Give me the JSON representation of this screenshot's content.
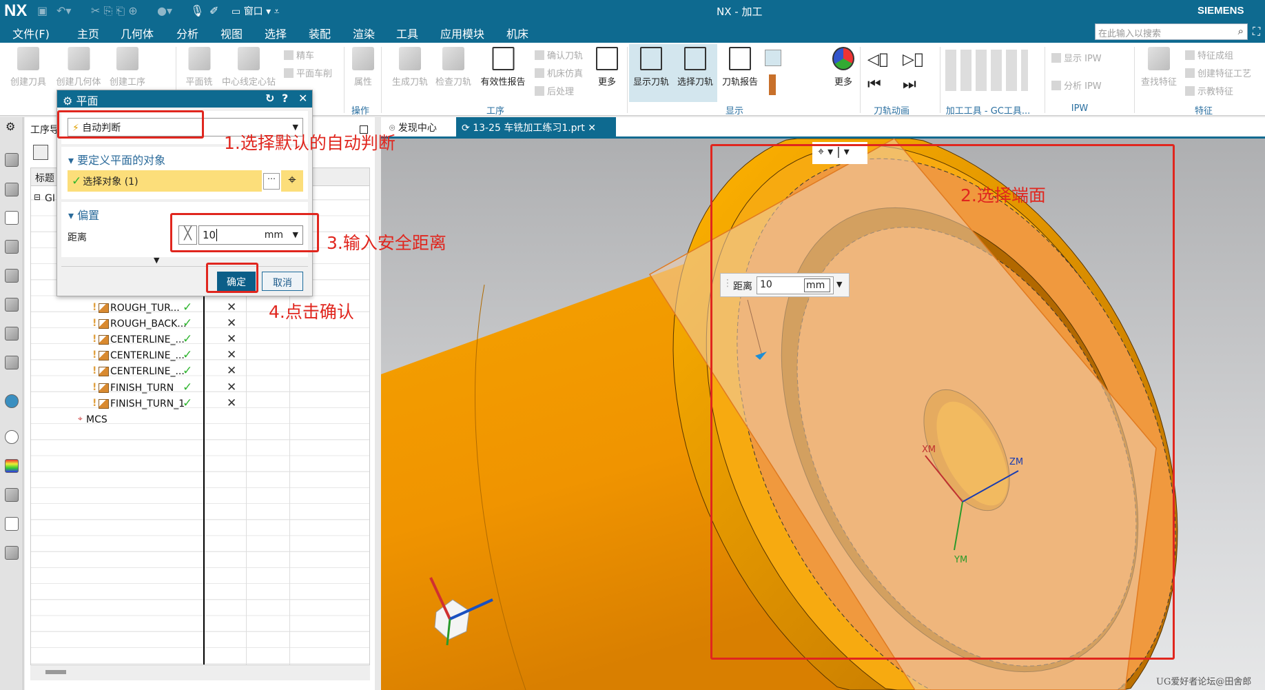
{
  "app": {
    "logo": "NX",
    "title": "NX - 加工",
    "brand": "SIEMENS",
    "window_menu": "窗口"
  },
  "menu": [
    "文件(F)",
    "主页",
    "几何体",
    "分析",
    "视图",
    "选择",
    "装配",
    "渲染",
    "工具",
    "应用模块",
    "机床"
  ],
  "search": {
    "placeholder": "在此输入以搜索"
  },
  "ribbon": {
    "buttons": [
      "创建刀具",
      "创建几何体",
      "创建工序",
      "平面铣",
      "中心线定心钻",
      "属性",
      "生成刀轨",
      "检查刀轨",
      "有效性报告",
      "更多",
      "显示刀轨",
      "选择刀轨",
      "刀轨报告",
      "更多",
      "查找特征"
    ],
    "small": [
      "精车",
      "平面车削",
      "确认刀轨",
      "机床仿真",
      "后处理",
      "显示 IPW",
      "分析 IPW",
      "特征成组",
      "创建特征工艺",
      "示教特征"
    ],
    "groups": [
      "操作",
      "工序",
      "显示",
      "刀轨动画",
      "加工工具 - GC工具...",
      "IPW",
      "特征"
    ]
  },
  "nav": {
    "title": "工序导",
    "header": "标题",
    "root": "GI",
    "rows": [
      "ROUGH_TUR...",
      "ROUGH_BACK...",
      "CENTERLINE_...",
      "CENTERLINE_...",
      "CENTERLINE_...",
      "FINISH_TURN",
      "FINISH_TURN_1"
    ],
    "mcs": "MCS",
    "check": "✓",
    "cross": "✕"
  },
  "tabs": [
    "发现中心",
    "13-25 车铣加工练习1.prt"
  ],
  "dialog": {
    "title": "平面",
    "type_value": "自动判断",
    "section1": "要定义平面的对象",
    "select_label": "选择对象 (1)",
    "section2": "偏置",
    "distance_label": "距离",
    "distance_value": "10",
    "unit": "mm",
    "ok": "确定",
    "cancel": "取消"
  },
  "floating_input": {
    "label": "距离",
    "value": "10",
    "unit": "mm"
  },
  "axes": {
    "x": "XM",
    "y": "YM",
    "z": "ZM"
  },
  "annotations": [
    "1.选择默认的自动判断",
    "2.选择端面",
    "3.输入安全距离",
    "4.点击确认"
  ],
  "watermark": "UG爱好者论坛@田舍郎",
  "colors": {
    "accent": "#0e6a90",
    "annotation": "#e0261e",
    "part": "#f29a1a",
    "selected_face": "#f0993e"
  }
}
